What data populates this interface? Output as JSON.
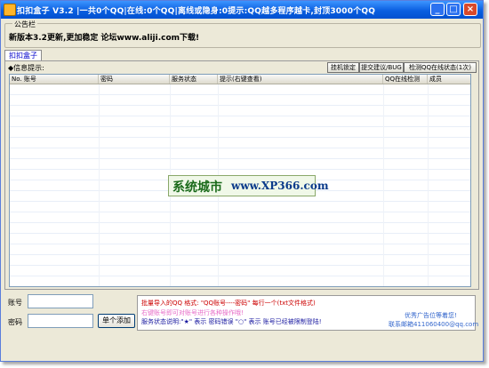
{
  "title": "扣扣盒子 V3.2 |一共0个QQ|在线:0个QQ|离线或隐身:0提示:QQ越多程序越卡,封顶3000个QQ",
  "window_controls": {
    "min": "_",
    "max": "□",
    "close": "×"
  },
  "bulletin": {
    "legend": "公告栏",
    "text": "新版本3.2更新,更加稳定 论坛www.aliji.com下载!"
  },
  "tab": "扣扣盒子",
  "info_label": "◆信息提示:",
  "toolbar_buttons": [
    "挂机锁定",
    "提交建议/BUG",
    "检测QQ在线状态(1次)"
  ],
  "table": {
    "columns": [
      "No. 账号",
      "密码",
      "服务状态",
      "提示(右键查看)",
      "QQ在线检测",
      "成员"
    ]
  },
  "watermark": {
    "left": "系统城市",
    "right": "www.XP366.com"
  },
  "form": {
    "account_label": "账号",
    "password_label": "密码",
    "add_button": "单个添加"
  },
  "hints": {
    "line1": "批量导入的QQ 格式: \"QQ账号----密码\" 每行一个(txt文件格式)",
    "line2": "右键账号即可对账号进行各种操作哦!",
    "line3": "服务状态说明:\"★\" 表示 密码错误 \"○\" 表示 账号已经被限制登陆!"
  },
  "ad": {
    "line1": "优秀广告位等着您!",
    "line2": "联系邮箱411060400@qq.com"
  }
}
